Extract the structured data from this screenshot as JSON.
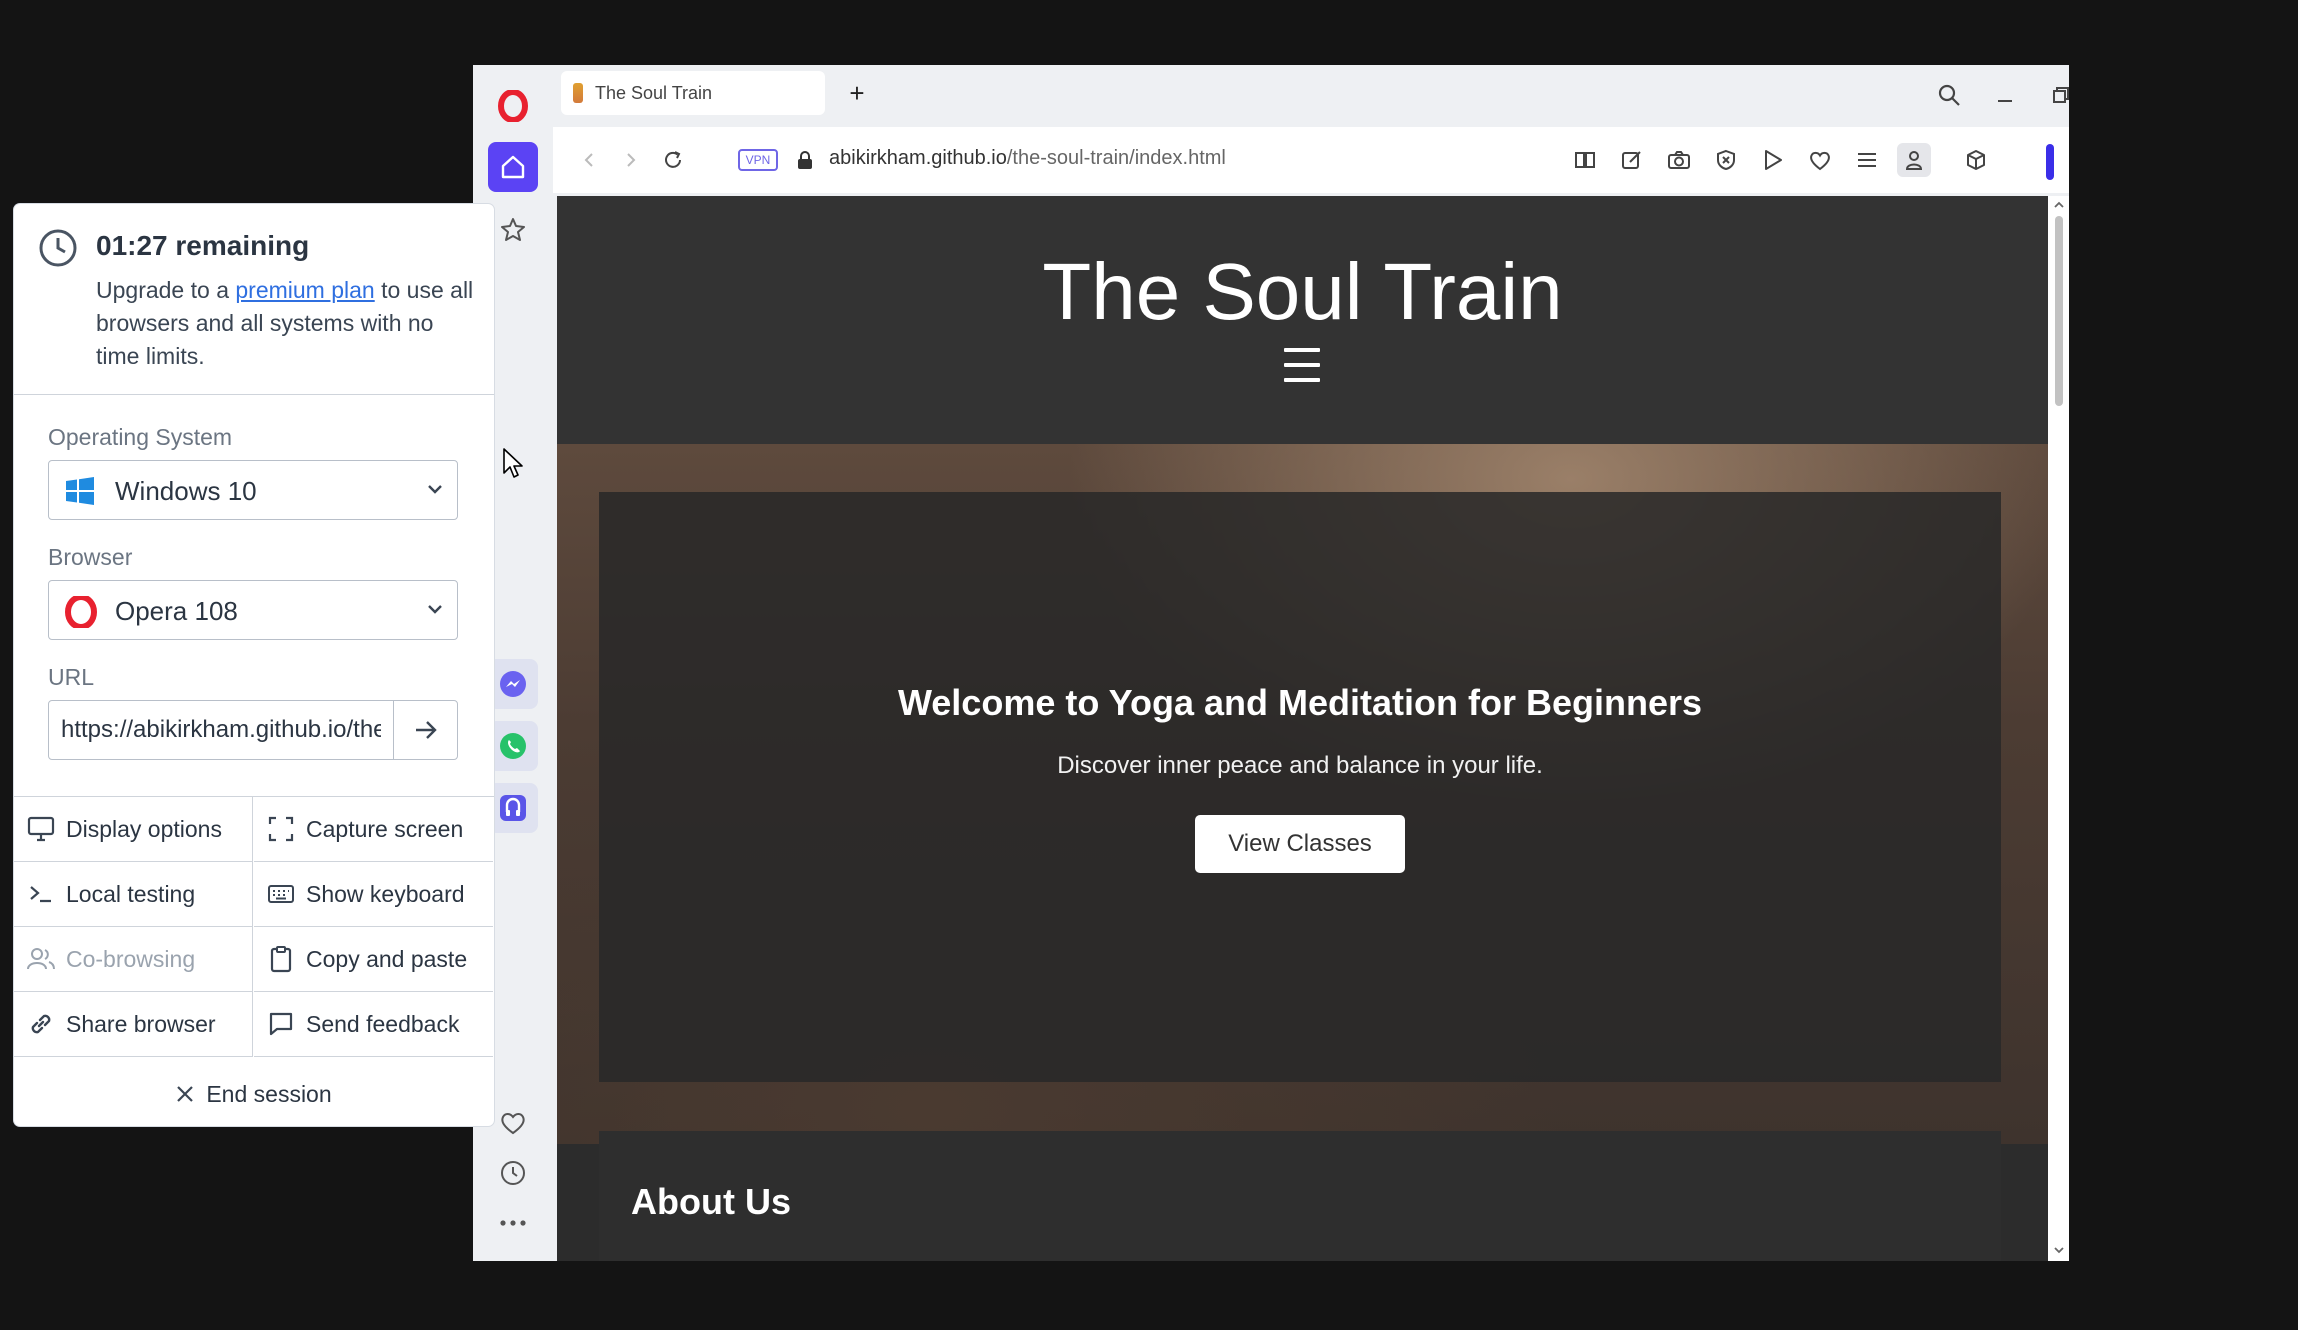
{
  "browser": {
    "tab_title": "The Soul Train",
    "new_tab_symbol": "+",
    "vpn_label": "VPN",
    "url_host": "abikirkham.github.io",
    "url_path": "/the-soul-train/index.html",
    "icons": [
      "opera-logo-icon",
      "home-icon",
      "pinboard-icon",
      "messenger-icon",
      "whatsapp-icon",
      "music-player-icon",
      "heart-icon",
      "history-icon",
      "more-icon",
      "search-icon",
      "minimize-icon",
      "restore-icon",
      "close-icon",
      "back-icon",
      "forward-icon",
      "reload-icon",
      "lock-icon",
      "reader-icon",
      "edit-icon",
      "camera-icon",
      "adblock-icon",
      "send-icon",
      "bookmark-icon",
      "easy-setup-icon",
      "profile-icon",
      "cube-icon"
    ]
  },
  "website": {
    "title": "The Soul Train",
    "hero_title": "Welcome to Yoga and Meditation for Beginners",
    "hero_subtitle": "Discover inner peace and balance in your life.",
    "cta_label": "View Classes",
    "about_title": "About Us"
  },
  "panel": {
    "timer": "01:27 remaining",
    "upgrade_prefix": "Upgrade to a ",
    "upgrade_link": "premium plan",
    "upgrade_suffix": " to use all browsers and all systems with no time limits.",
    "os_label": "Operating System",
    "os_value": "Windows 10",
    "browser_label": "Browser",
    "browser_value": "Opera 108",
    "url_label": "URL",
    "url_value": "https://abikirkham.github.io/the-soul-train/index.html",
    "actions": {
      "display_options": "Display options",
      "capture_screen": "Capture screen",
      "local_testing": "Local testing",
      "show_keyboard": "Show keyboard",
      "co_browsing": "Co-browsing",
      "copy_paste": "Copy and paste",
      "share_browser": "Share browser",
      "send_feedback": "Send feedback"
    },
    "end_session": "End session"
  },
  "colors": {
    "opera_red": "#e8212f",
    "opera_accent": "#5b43f4",
    "link_blue": "#2f6fe0",
    "windows_blue": "#1f8be0"
  }
}
